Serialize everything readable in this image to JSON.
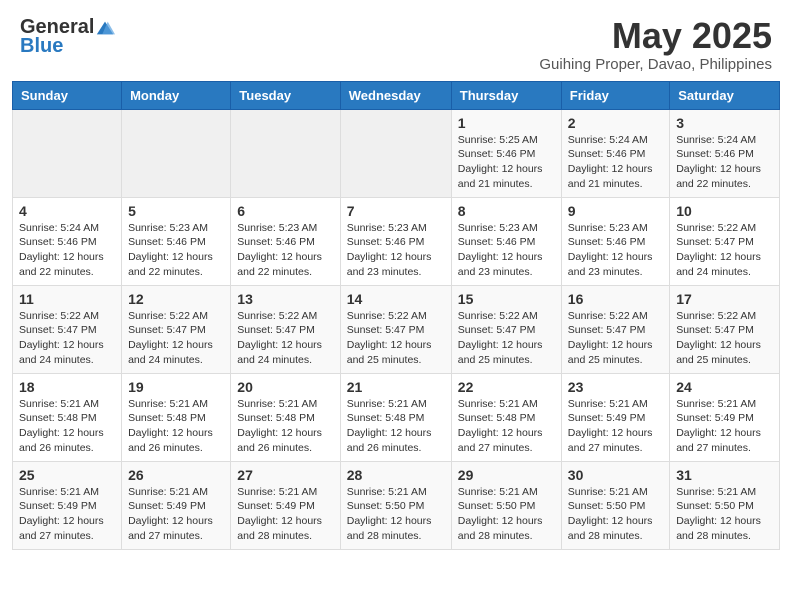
{
  "header": {
    "logo_general": "General",
    "logo_blue": "Blue",
    "month_title": "May 2025",
    "location": "Guihing Proper, Davao, Philippines"
  },
  "calendar": {
    "days_of_week": [
      "Sunday",
      "Monday",
      "Tuesday",
      "Wednesday",
      "Thursday",
      "Friday",
      "Saturday"
    ],
    "weeks": [
      [
        {
          "day": "",
          "info": ""
        },
        {
          "day": "",
          "info": ""
        },
        {
          "day": "",
          "info": ""
        },
        {
          "day": "",
          "info": ""
        },
        {
          "day": "1",
          "info": "Sunrise: 5:25 AM\nSunset: 5:46 PM\nDaylight: 12 hours\nand 21 minutes."
        },
        {
          "day": "2",
          "info": "Sunrise: 5:24 AM\nSunset: 5:46 PM\nDaylight: 12 hours\nand 21 minutes."
        },
        {
          "day": "3",
          "info": "Sunrise: 5:24 AM\nSunset: 5:46 PM\nDaylight: 12 hours\nand 22 minutes."
        }
      ],
      [
        {
          "day": "4",
          "info": "Sunrise: 5:24 AM\nSunset: 5:46 PM\nDaylight: 12 hours\nand 22 minutes."
        },
        {
          "day": "5",
          "info": "Sunrise: 5:23 AM\nSunset: 5:46 PM\nDaylight: 12 hours\nand 22 minutes."
        },
        {
          "day": "6",
          "info": "Sunrise: 5:23 AM\nSunset: 5:46 PM\nDaylight: 12 hours\nand 22 minutes."
        },
        {
          "day": "7",
          "info": "Sunrise: 5:23 AM\nSunset: 5:46 PM\nDaylight: 12 hours\nand 23 minutes."
        },
        {
          "day": "8",
          "info": "Sunrise: 5:23 AM\nSunset: 5:46 PM\nDaylight: 12 hours\nand 23 minutes."
        },
        {
          "day": "9",
          "info": "Sunrise: 5:23 AM\nSunset: 5:46 PM\nDaylight: 12 hours\nand 23 minutes."
        },
        {
          "day": "10",
          "info": "Sunrise: 5:22 AM\nSunset: 5:47 PM\nDaylight: 12 hours\nand 24 minutes."
        }
      ],
      [
        {
          "day": "11",
          "info": "Sunrise: 5:22 AM\nSunset: 5:47 PM\nDaylight: 12 hours\nand 24 minutes."
        },
        {
          "day": "12",
          "info": "Sunrise: 5:22 AM\nSunset: 5:47 PM\nDaylight: 12 hours\nand 24 minutes."
        },
        {
          "day": "13",
          "info": "Sunrise: 5:22 AM\nSunset: 5:47 PM\nDaylight: 12 hours\nand 24 minutes."
        },
        {
          "day": "14",
          "info": "Sunrise: 5:22 AM\nSunset: 5:47 PM\nDaylight: 12 hours\nand 25 minutes."
        },
        {
          "day": "15",
          "info": "Sunrise: 5:22 AM\nSunset: 5:47 PM\nDaylight: 12 hours\nand 25 minutes."
        },
        {
          "day": "16",
          "info": "Sunrise: 5:22 AM\nSunset: 5:47 PM\nDaylight: 12 hours\nand 25 minutes."
        },
        {
          "day": "17",
          "info": "Sunrise: 5:22 AM\nSunset: 5:47 PM\nDaylight: 12 hours\nand 25 minutes."
        }
      ],
      [
        {
          "day": "18",
          "info": "Sunrise: 5:21 AM\nSunset: 5:48 PM\nDaylight: 12 hours\nand 26 minutes."
        },
        {
          "day": "19",
          "info": "Sunrise: 5:21 AM\nSunset: 5:48 PM\nDaylight: 12 hours\nand 26 minutes."
        },
        {
          "day": "20",
          "info": "Sunrise: 5:21 AM\nSunset: 5:48 PM\nDaylight: 12 hours\nand 26 minutes."
        },
        {
          "day": "21",
          "info": "Sunrise: 5:21 AM\nSunset: 5:48 PM\nDaylight: 12 hours\nand 26 minutes."
        },
        {
          "day": "22",
          "info": "Sunrise: 5:21 AM\nSunset: 5:48 PM\nDaylight: 12 hours\nand 27 minutes."
        },
        {
          "day": "23",
          "info": "Sunrise: 5:21 AM\nSunset: 5:49 PM\nDaylight: 12 hours\nand 27 minutes."
        },
        {
          "day": "24",
          "info": "Sunrise: 5:21 AM\nSunset: 5:49 PM\nDaylight: 12 hours\nand 27 minutes."
        }
      ],
      [
        {
          "day": "25",
          "info": "Sunrise: 5:21 AM\nSunset: 5:49 PM\nDaylight: 12 hours\nand 27 minutes."
        },
        {
          "day": "26",
          "info": "Sunrise: 5:21 AM\nSunset: 5:49 PM\nDaylight: 12 hours\nand 27 minutes."
        },
        {
          "day": "27",
          "info": "Sunrise: 5:21 AM\nSunset: 5:49 PM\nDaylight: 12 hours\nand 28 minutes."
        },
        {
          "day": "28",
          "info": "Sunrise: 5:21 AM\nSunset: 5:50 PM\nDaylight: 12 hours\nand 28 minutes."
        },
        {
          "day": "29",
          "info": "Sunrise: 5:21 AM\nSunset: 5:50 PM\nDaylight: 12 hours\nand 28 minutes."
        },
        {
          "day": "30",
          "info": "Sunrise: 5:21 AM\nSunset: 5:50 PM\nDaylight: 12 hours\nand 28 minutes."
        },
        {
          "day": "31",
          "info": "Sunrise: 5:21 AM\nSunset: 5:50 PM\nDaylight: 12 hours\nand 28 minutes."
        }
      ]
    ]
  }
}
